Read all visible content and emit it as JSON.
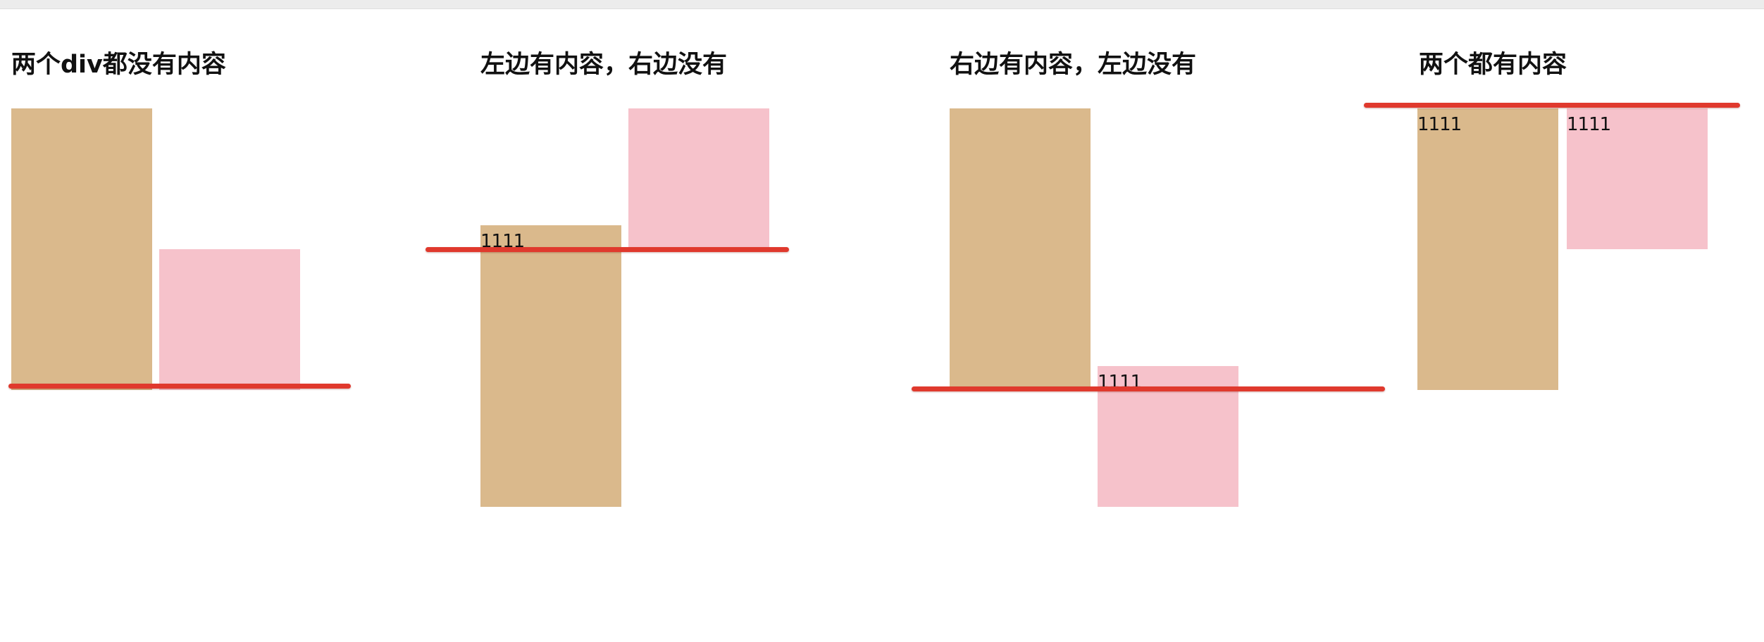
{
  "colors": {
    "left_box": "#dab98c",
    "right_box": "#f6c2cb",
    "baseline_marker": "#e0392d",
    "heading_text": "#111111"
  },
  "panels": [
    {
      "heading": "两个div都没有内容",
      "left_box": {
        "content": ""
      },
      "right_box": {
        "content": ""
      }
    },
    {
      "heading": "左边有内容，右边没有",
      "left_box": {
        "content": "1111"
      },
      "right_box": {
        "content": ""
      }
    },
    {
      "heading": "右边有内容，左边没有",
      "left_box": {
        "content": ""
      },
      "right_box": {
        "content": "1111"
      }
    },
    {
      "heading": "两个都有内容",
      "left_box": {
        "content": "1111"
      },
      "right_box": {
        "content": "1111"
      }
    }
  ]
}
